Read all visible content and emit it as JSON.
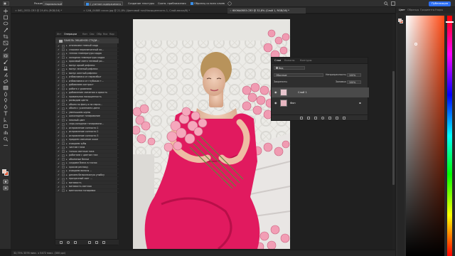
{
  "options_bar": {
    "mode_label": "Режим:",
    "mode_value": "Нормальный",
    "sample_all": "С учетом содержимого",
    "texture": "Создание текстуры",
    "proximity": "Соотв. приближения",
    "sample_layers": "Образец со всех слоев",
    "publish": "Публикация"
  },
  "tabs": [
    {
      "label": "IMG_0532.CR3 @ 29,6% (RGB/16) *"
    },
    {
      "label": "CAN_04885 xxxxx.jpg @ 21,8% (Цветовой тон/Насыщенность 1, Слой-маска/8) *"
    },
    {
      "label": "6006A0B53.CR3 @ 32,8% (Слой 1, RGB/16) *"
    }
  ],
  "operations": {
    "tabs": [
      "Ист",
      "Операции",
      "Кан",
      "Сво",
      "Обр",
      "Кис",
      "Кор"
    ],
    "folder": "ПАНЕЛЬ ЭКШЕНОВ СТУДИ...",
    "items": [
      "отвлекаем темный кадр",
      "спасаем пересвеченный ка...",
      "теплая температура кадра",
      "холодная температура кадра",
      "красивый свето теневой ри...",
      "минус яркий рефлекс",
      "минус зеленый рефлекс",
      "минус желтый рефлекс",
      "избавляемся от переизбыт",
      "избавляемся от глубоких т...",
      "добавляем контраст",
      "работа с уровнями",
      "добавление свечения и яркость",
      "правильная насыщенность",
      "разводим цвета",
      "объем по фону и на персо...",
      "объем с усилением цвета",
      "уменьшаем шумы",
      "шоколадное тонирование",
      "нежный цвет",
      "серо-холодное тонировани...",
      "исправление сонности 1",
      "исправление сонности 2",
      "исправление сонности 3",
      "придаем свечение коже",
      "очищаем зубы",
      "чистим глаза",
      "только светлые тона",
      "работаем с цветом глаз",
      "объемные белки",
      "создаем блеск в глазах",
      "красим респицу",
      "очищаем волосы ...",
      "делаем белоснежную улыбку",
      "прозрачный свет ...",
      "матовость",
      "матовость светлая",
      "винтажная тонировка"
    ]
  },
  "layers": {
    "tabs": [
      "Слои",
      "Каналы",
      "Контуры"
    ],
    "filter_label": "Вид",
    "blend_mode": "Обычные",
    "opacity_label": "Непрозрачность:",
    "opacity_value": "100%",
    "lock_label": "Закрепить:",
    "fill_label": "Заливка:",
    "fill_value": "100%",
    "items": [
      {
        "name": "Слой 1"
      },
      {
        "name": "Фон"
      }
    ]
  },
  "right_panel": {
    "tabs": [
      "Цвет",
      "Образцы",
      "Градиенты",
      "Узоры"
    ]
  },
  "status": {
    "text": "32,75%   3376 пикс. x 5472 пикс. (300 ppi)"
  },
  "colors": {
    "foreground": "#f3c9b8",
    "background": "#e2502b",
    "accent": "#2d6ff2"
  }
}
